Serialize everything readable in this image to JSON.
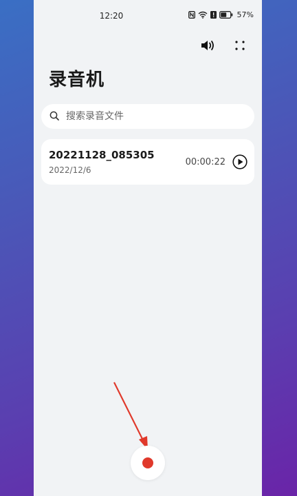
{
  "status_bar": {
    "time": "12:20",
    "battery": "57%"
  },
  "header": {
    "title": "录音机",
    "speaker_icon": "speaker-icon",
    "more_icon": "more-dots-icon"
  },
  "search": {
    "placeholder": "搜索录音文件",
    "value": "",
    "icon": "search-icon"
  },
  "recordings": [
    {
      "name": "20221128_085305",
      "date": "2022/12/6",
      "duration": "00:00:22",
      "icon": "play-icon"
    }
  ],
  "record_button": {
    "icon": "record-dot-icon",
    "color": "#e0392b"
  },
  "colors": {
    "accent_red": "#e0392b",
    "background": "#f1f3f5",
    "card": "#ffffff"
  }
}
